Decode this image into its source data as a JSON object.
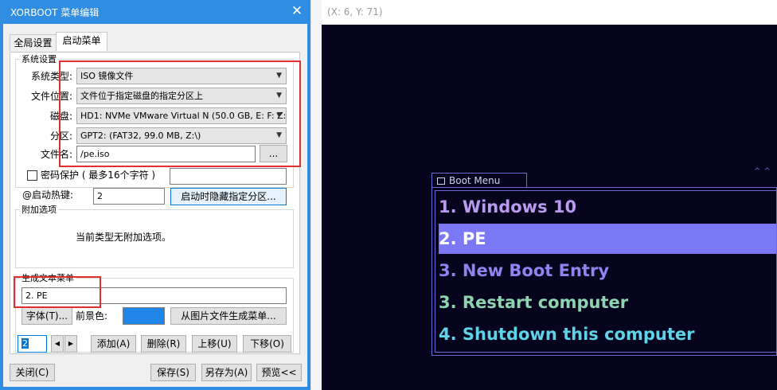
{
  "window": {
    "title": "XORBOOT 菜单编辑",
    "close_glyph": "✕"
  },
  "tabs": [
    {
      "label": "全局设置"
    },
    {
      "label": "启动菜单"
    }
  ],
  "system": {
    "group_label": "系统设置",
    "type_label": "系统类型:",
    "type_value": "ISO 镜像文件",
    "location_label": "文件位置:",
    "location_value": "文件位于指定磁盘的指定分区上",
    "disk_label": "磁盘:",
    "disk_value": "HD1: NVMe VMware Virtual N (50.0 GB, E: F: Z:)",
    "partition_label": "分区:",
    "partition_value": "GPT2: (FAT32,  99.0 MB, Z:\\)",
    "filename_label": "文件名:",
    "filename_value": "/pe.iso",
    "browse_label": "..."
  },
  "password": {
    "label": "密码保护 ( 最多16个字符 )",
    "value": ""
  },
  "hotkey": {
    "label": "@启动热键:",
    "value": "2",
    "hide_partition_label": "启动时隐藏指定分区..."
  },
  "extra": {
    "group_label": "附加选项",
    "message": "当前类型无附加选项。"
  },
  "text_menu": {
    "group_label": "生成文本菜单",
    "value": "2. PE",
    "font_label": "字体(T)...",
    "fg_label": "前景色:",
    "fg_color": "#1f86e8",
    "from_image_label": "从图片文件生成菜单..."
  },
  "index": {
    "value": "2"
  },
  "actions": {
    "add": "添加(A)",
    "delete": "删除(R)",
    "up": "上移(U)",
    "down": "下移(O)"
  },
  "footer": {
    "close": "关闭(C)",
    "save": "保存(S)",
    "save_as": "另存为(A)",
    "preview": "预览<<"
  },
  "preview": {
    "coords": "(X: 6, Y: 71)",
    "menu_title": "Boot Menu",
    "entries": [
      {
        "text": "1.  Windows 10",
        "color": "#b99af0"
      },
      {
        "text": "2. PE",
        "color": "#ffffff"
      },
      {
        "text": "3.  New Boot Entry",
        "color": "#8f84f0"
      },
      {
        "text": "3.  Restart computer",
        "color": "#8fd4b0"
      },
      {
        "text": "4.  Shutdown this computer",
        "color": "#5fd3e8"
      }
    ],
    "selected_color": "#7a78f5",
    "border_color": "#6b6ad8",
    "background": "#07051e"
  }
}
